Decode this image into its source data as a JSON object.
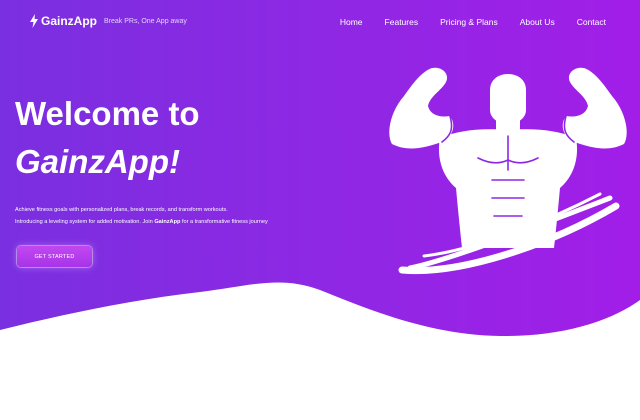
{
  "brand": {
    "name": "GainzApp",
    "tagline": "Break PRs, One App away",
    "logo_icon": "lightning-bolt-icon"
  },
  "nav": {
    "links": [
      "Home",
      "Features",
      "Pricing & Plans",
      "About Us",
      "Contact"
    ]
  },
  "hero": {
    "headline_line1": "Welcome to",
    "headline_line2": "GainzApp!",
    "description_line1": "Achieve fitness goals with personalized plans, break records, and transform workouts.",
    "description_line2_pre": "Introducing a leveling system for added motivation. Join ",
    "description_line2_brand": "GainzApp",
    "description_line2_post": " for a transformative fitness journey",
    "cta_label": "GET STARTED",
    "illustration_icon": "flexing-strongman-icon"
  },
  "colors": {
    "gradient_start": "#7a2fe0",
    "gradient_end": "#a21ee8",
    "text": "#ffffff",
    "background": "#ffffff"
  }
}
